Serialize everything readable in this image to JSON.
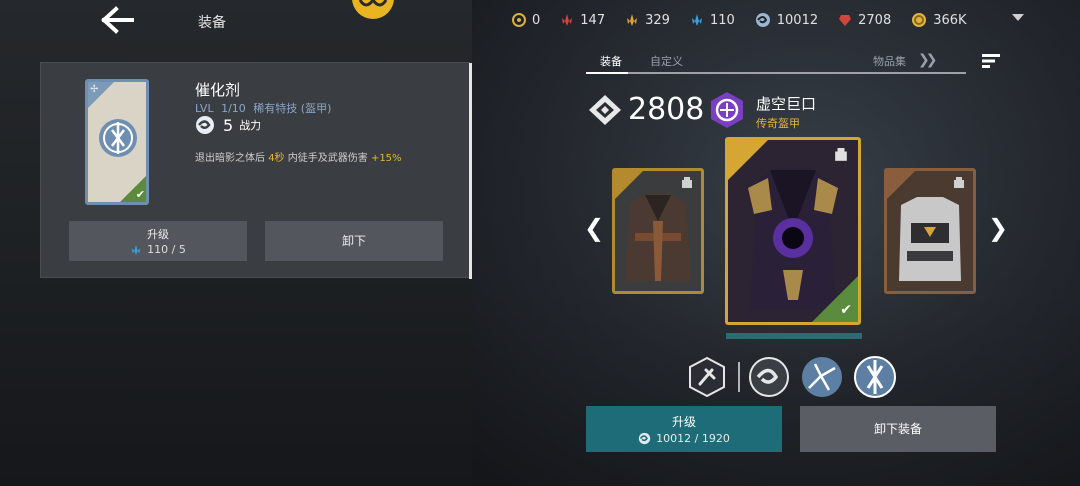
{
  "header": {
    "back_icon": "back-arrow-icon",
    "title": "装备",
    "logo_icon": "faction-logo-icon"
  },
  "currencies": [
    {
      "icon": "gear-coin-icon",
      "value": "0",
      "color": "#d9b13b"
    },
    {
      "icon": "red-crystal-icon",
      "value": "147",
      "color": "#d6433b"
    },
    {
      "icon": "gold-crystal-icon",
      "value": "329",
      "color": "#d8a43a"
    },
    {
      "icon": "blue-crystal-icon",
      "value": "110",
      "color": "#3aa0d9"
    },
    {
      "icon": "swirl-icon",
      "value": "10012",
      "color": "#9ab6d0"
    },
    {
      "icon": "red-gem-icon",
      "value": "2708",
      "color": "#d0463b"
    },
    {
      "icon": "gold-coin-icon",
      "value": "366K",
      "color": "#e2b440"
    }
  ],
  "item_panel": {
    "name": "催化剂",
    "level_label": "LVL",
    "level": "1/10",
    "type": "稀有特技 (盔甲)",
    "power_value": "5",
    "power_label": "战力",
    "desc_part1": "退出暗影之体后",
    "desc_highlight1": "4秒",
    "desc_part2": "内徒手及武器伤害",
    "desc_highlight2": "+15%",
    "upgrade_label": "升级",
    "upgrade_cost": "110 / 5",
    "unequip_label": "卸下"
  },
  "tabs": {
    "equip": "装备",
    "custom": "自定义",
    "collection": "物品集"
  },
  "gear": {
    "score": "2808",
    "set_name": "虚空巨口",
    "set_rarity": "传奇盔甲"
  },
  "bottom": {
    "upgrade_label": "升级",
    "upgrade_cost": "10012 / 1920",
    "unequip_label": "卸下装备"
  },
  "colors": {
    "accent_teal": "#1d6c78",
    "legendary_gold": "#d6a632",
    "highlight": "#e7b53a"
  }
}
